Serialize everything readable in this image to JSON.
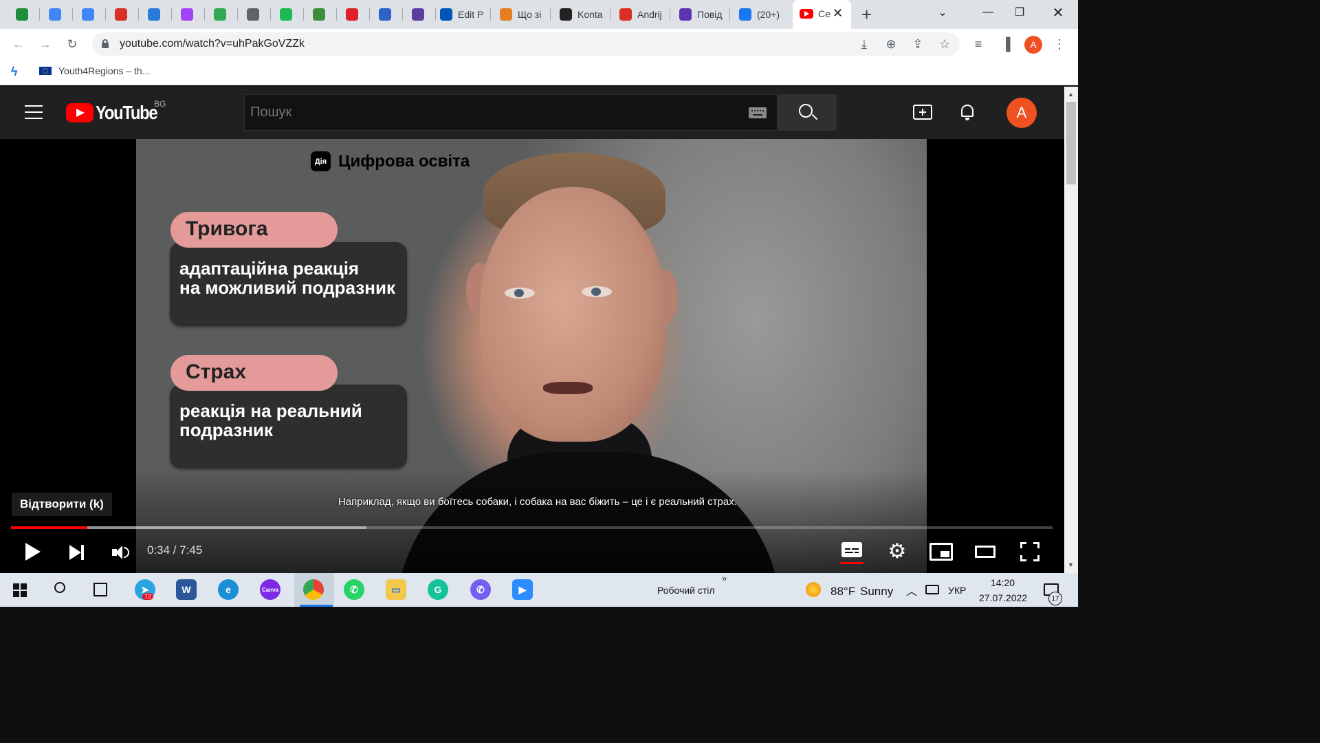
{
  "browser": {
    "tabs": [
      {
        "label": "",
        "icon": "google-drive-icon",
        "color": "#1e8e3e"
      },
      {
        "label": "",
        "icon": "google-docs-icon",
        "color": "#4285f4"
      },
      {
        "label": "",
        "icon": "google-translate-icon",
        "color": "#4285f4"
      },
      {
        "label": "",
        "icon": "gmail-icon",
        "color": "#d93025"
      },
      {
        "label": "",
        "icon": "browser-e-icon",
        "color": "#2a7ad8"
      },
      {
        "label": "",
        "icon": "podcast-icon",
        "color": "#a142f4"
      },
      {
        "label": "",
        "icon": "google-podcasts-icon",
        "color": "#34a853"
      },
      {
        "label": "",
        "icon": "globe-icon",
        "color": "#5f6368"
      },
      {
        "label": "",
        "icon": "spotify-icon",
        "color": "#1db954"
      },
      {
        "label": "",
        "icon": "anchor-icon",
        "color": "#3b8e3b"
      },
      {
        "label": "",
        "icon": "infinity-icon",
        "color": "#e0202a"
      },
      {
        "label": "",
        "icon": "flag-icon",
        "color": "#2b63c7"
      },
      {
        "label": "",
        "icon": "bird-icon",
        "color": "#5b3e9c"
      }
    ],
    "named_tabs": [
      {
        "label": "Edit P",
        "icon": "u-icon",
        "color": "#0057b7"
      },
      {
        "label": "Що зі",
        "icon": "flame-icon",
        "color": "#e67e22"
      },
      {
        "label": "Konta",
        "icon": "fox-icon",
        "color": "#222222"
      },
      {
        "label": "Andrij",
        "icon": "b-icon",
        "color": "#d93025"
      },
      {
        "label": "Повід",
        "icon": "forms-icon",
        "color": "#5e35b1"
      },
      {
        "label": "(20+)",
        "icon": "facebook-icon",
        "color": "#1877f2"
      }
    ],
    "active_tab_label": "Ce",
    "url": "youtube.com/watch?v=uhPakGoVZZk",
    "bookmark": "Youth4Regions – th...",
    "profile_letter": "A"
  },
  "youtube": {
    "logo_text": "YouTube",
    "country": "BG",
    "search_placeholder": "Пошук",
    "avatar_letter": "A"
  },
  "video": {
    "brand_logo": "Дія",
    "brand_text": "Цифрова освіта",
    "card1_title": "Тривога",
    "card1_body_line1": "адаптаційна реакція",
    "card1_body_line2": "на можливий подразник",
    "card2_title": "Страх",
    "card2_body_line1": "реакція на реальний",
    "card2_body_line2": "подразник",
    "subtitle": "Наприклад, якщо ви боїтесь собаки, і собака на вас біжить – це і є реальний страх.",
    "tooltip": "Відтворити (k)",
    "time": "0:34 / 7:45",
    "played_fraction": 0.073,
    "buffered_fraction": 0.341
  },
  "taskbar": {
    "telegram_badge": "72",
    "desktop_label": "Робочий стіл",
    "weather_temp": "88°F",
    "weather_text": "Sunny",
    "lang": "УКР",
    "clock_time": "14:20",
    "clock_date": "27.07.2022",
    "notifications": "17"
  },
  "colors": {
    "youtube_red": "#ff0000",
    "avatar_orange": "#ef5122",
    "card_pink": "#e59a9a"
  }
}
